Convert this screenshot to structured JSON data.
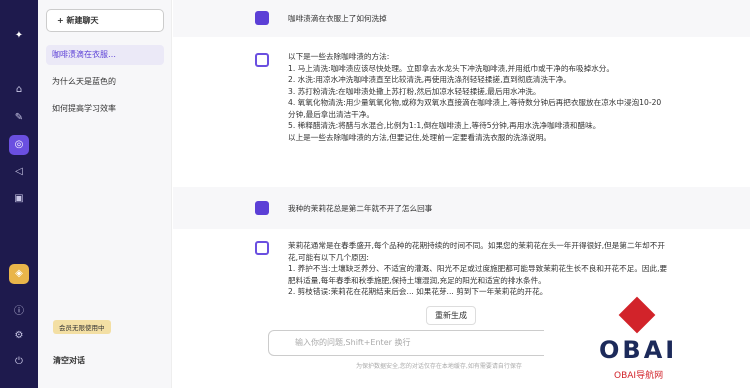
{
  "sidebar": {
    "new_chat": "+ 新建聊天",
    "items": [
      "咖啡渍滴在衣服…",
      "为什么天是蓝色的",
      "如何提高学习效率"
    ],
    "vip": "会员无限使用中",
    "clear": "清空对话"
  },
  "chat": {
    "q1": "咖啡渍滴在衣服上了如何洗掉",
    "a1": "以下是一些去除咖啡渍的方法:\n1. 马上清洗:咖啡渍应该尽快处理。立即拿去水龙头下冲洗咖啡渍,并用纸巾或干净的布吸掉水分。\n2. 水洗:用凉水冲洗咖啡渍直至比较清洗,再使用洗涤剂轻轻揉搓,直到彻底清洗干净。\n3. 苏打粉清洗:在咖啡渍处撒上苏打粉,然后加凉水轻轻揉搓,最后用水冲洗。\n4. 氧氧化物清洗:用少量氧氧化物,或称为双氧水直接滴在咖啡渍上,等待数分钟后再把衣服放在凉水中浸泡10-20分钟,最后拿出清洁干净。\n5. 稀释醋清洗:将醋与水混合,比例为1:1,倒在咖啡渍上,等待5分钟,再用水洗净咖啡渍和醋味。\n以上是一些去除咖啡渍的方法,但要记住,处理前一定要看清洗衣服的洗涤说明。",
    "q2": "我种的茉莉花总是第二年就不开了怎么回事",
    "a2": "茉莉花通常是在春季盛开,每个品种的花期持续的时间不同。如果您的茉莉花在头一年开得很好,但是第二年却不开花,可能有以下几个原因:\n1. 养护不当:土壤缺乏养分、不适宜的灌溉、阳光不足或过度施肥都可能导致茉莉花生长不良和开花不足。因此,要肥料适量,每年春季和秋季施肥,保持土壤湿润,充足的阳光和适宜的排水条件。\n2. 剪枝错误:茉莉花在花期结束后会... 如果花芽... 剪到下一年茉莉花的开花。",
    "regen": "重新生成",
    "input_placeholder": "输入你的问题,Shift+Enter 换行",
    "footer": "为保护数据安全,您的对话仅存在本地缓存,如有需要请自行保存"
  },
  "logo": {
    "brand": "OBAI",
    "sub": "OBAI导航网"
  }
}
